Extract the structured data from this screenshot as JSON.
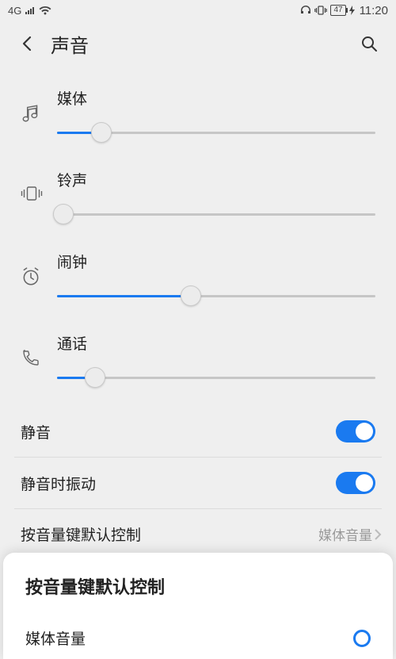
{
  "status": {
    "network": "4G",
    "battery": "47",
    "time": "11:20"
  },
  "header": {
    "title": "声音"
  },
  "sliders": {
    "media": {
      "label": "媒体",
      "percent": 14
    },
    "ring": {
      "label": "铃声",
      "percent": 2
    },
    "alarm": {
      "label": "闹钟",
      "percent": 42
    },
    "call": {
      "label": "通话",
      "percent": 12
    }
  },
  "toggles": {
    "mute": {
      "label": "静音",
      "on": true
    },
    "vibrate_muted": {
      "label": "静音时振动",
      "on": true
    }
  },
  "volume_key_row": {
    "label": "按音量键默认控制",
    "value": "媒体音量"
  },
  "sheet": {
    "title": "按音量键默认控制",
    "option_media": "媒体音量"
  }
}
